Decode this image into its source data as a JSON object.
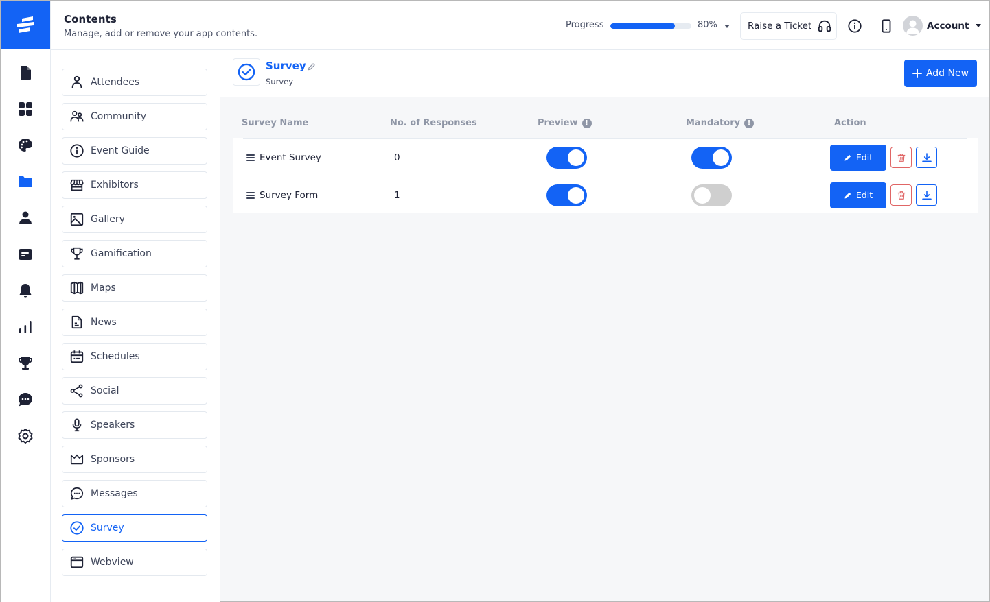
{
  "header": {
    "title": "Contents",
    "subtitle": "Manage, add or remove your app contents.",
    "progress": {
      "label": "Progress",
      "value_text": "80%",
      "value": 0.8
    },
    "raise_ticket_label": "Raise a Ticket",
    "account_label": "Account"
  },
  "rail": {
    "items": [
      {
        "name": "document",
        "active": false
      },
      {
        "name": "dashboard",
        "active": false
      },
      {
        "name": "palette",
        "active": false
      },
      {
        "name": "folder",
        "active": true
      },
      {
        "name": "user",
        "active": false
      },
      {
        "name": "card",
        "active": false
      },
      {
        "name": "bell",
        "active": false
      },
      {
        "name": "analytics",
        "active": false
      },
      {
        "name": "trophy",
        "active": false
      },
      {
        "name": "chat",
        "active": false
      },
      {
        "name": "settings",
        "active": false
      }
    ]
  },
  "sidebar": {
    "items": [
      {
        "label": "Attendees",
        "icon": "person-icon"
      },
      {
        "label": "Community",
        "icon": "people-icon"
      },
      {
        "label": "Event Guide",
        "icon": "info-icon"
      },
      {
        "label": "Exhibitors",
        "icon": "store-icon"
      },
      {
        "label": "Gallery",
        "icon": "image-icon"
      },
      {
        "label": "Gamification",
        "icon": "trophy-icon"
      },
      {
        "label": "Maps",
        "icon": "map-icon"
      },
      {
        "label": "News",
        "icon": "news-icon"
      },
      {
        "label": "Schedules",
        "icon": "calendar-icon"
      },
      {
        "label": "Social",
        "icon": "share-icon"
      },
      {
        "label": "Speakers",
        "icon": "microphone-icon"
      },
      {
        "label": "Sponsors",
        "icon": "crown-icon"
      },
      {
        "label": "Messages",
        "icon": "message-icon"
      },
      {
        "label": "Survey",
        "icon": "check-circle-icon",
        "active": true
      },
      {
        "label": "Webview",
        "icon": "browser-icon"
      }
    ]
  },
  "page": {
    "title": "Survey",
    "subtitle": "Survey",
    "add_new_label": "Add New"
  },
  "table": {
    "columns": [
      "Survey Name",
      "No. of Responses",
      "Preview",
      "Mandatory",
      "Action"
    ],
    "edit_label": "Edit",
    "rows": [
      {
        "name": "Event Survey",
        "responses": "0",
        "preview": true,
        "mandatory": true
      },
      {
        "name": "Survey Form",
        "responses": "1",
        "preview": true,
        "mandatory": false
      }
    ]
  },
  "colors": {
    "accent": "#1363f5",
    "text_dark": "#1e2235",
    "danger": "#e06666",
    "toggle_off": "#cfcfcf"
  }
}
